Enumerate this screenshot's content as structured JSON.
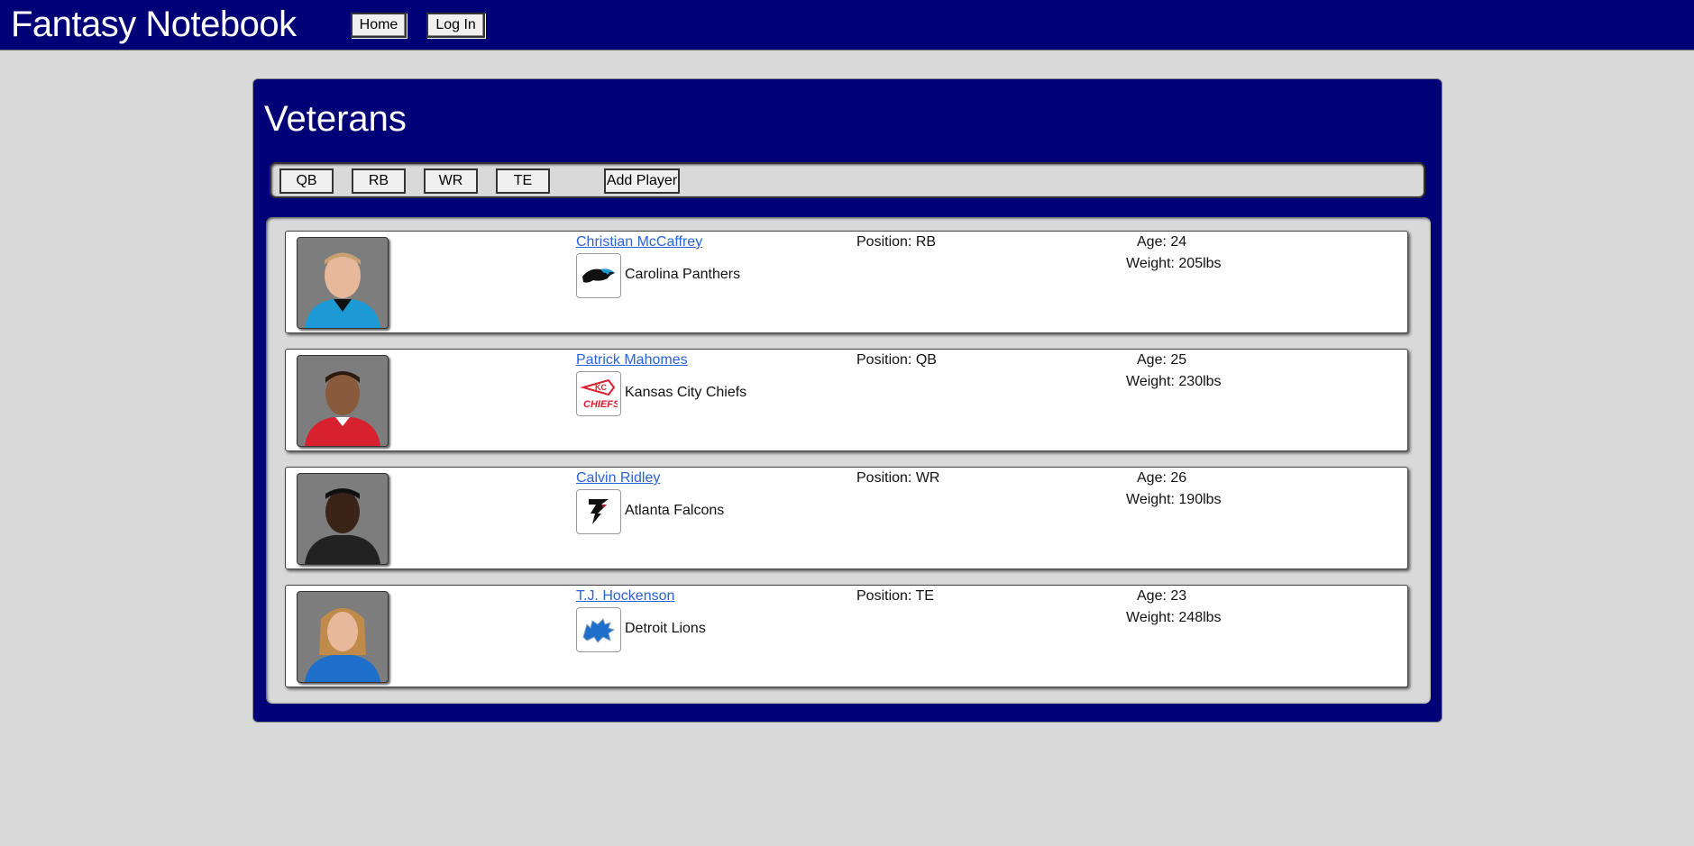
{
  "header": {
    "title": "Fantasy Notebook",
    "nav": [
      {
        "label": "Home"
      },
      {
        "label": "Log In"
      }
    ]
  },
  "main": {
    "title": "Veterans",
    "filters": [
      "QB",
      "RB",
      "WR",
      "TE"
    ],
    "add_label": "Add Player",
    "players": [
      {
        "name": "Christian McCaffrey",
        "team": "Carolina Panthers",
        "position": "Position: RB",
        "age": "Age: 24",
        "weight": "Weight: 205lbs",
        "logo_icon": "panthers-logo",
        "jersey_color": "#1c9ad6"
      },
      {
        "name": "Patrick Mahomes",
        "team": "Kansas City Chiefs",
        "position": "Position: QB",
        "age": "Age: 25",
        "weight": "Weight: 230lbs",
        "logo_icon": "chiefs-logo",
        "jersey_color": "#d8212f"
      },
      {
        "name": "Calvin Ridley",
        "team": "Atlanta Falcons",
        "position": "Position: WR",
        "age": "Age: 26",
        "weight": "Weight: 190lbs",
        "logo_icon": "falcons-logo",
        "jersey_color": "#222222"
      },
      {
        "name": "T.J. Hockenson",
        "team": "Detroit Lions",
        "position": "Position: TE",
        "age": "Age: 23",
        "weight": "Weight: 248lbs",
        "logo_icon": "lions-logo",
        "jersey_color": "#1e6fc9"
      }
    ]
  },
  "colors": {
    "header_bg": "#000077",
    "page_bg": "#d9d9d9",
    "link": "#2a62d9"
  }
}
